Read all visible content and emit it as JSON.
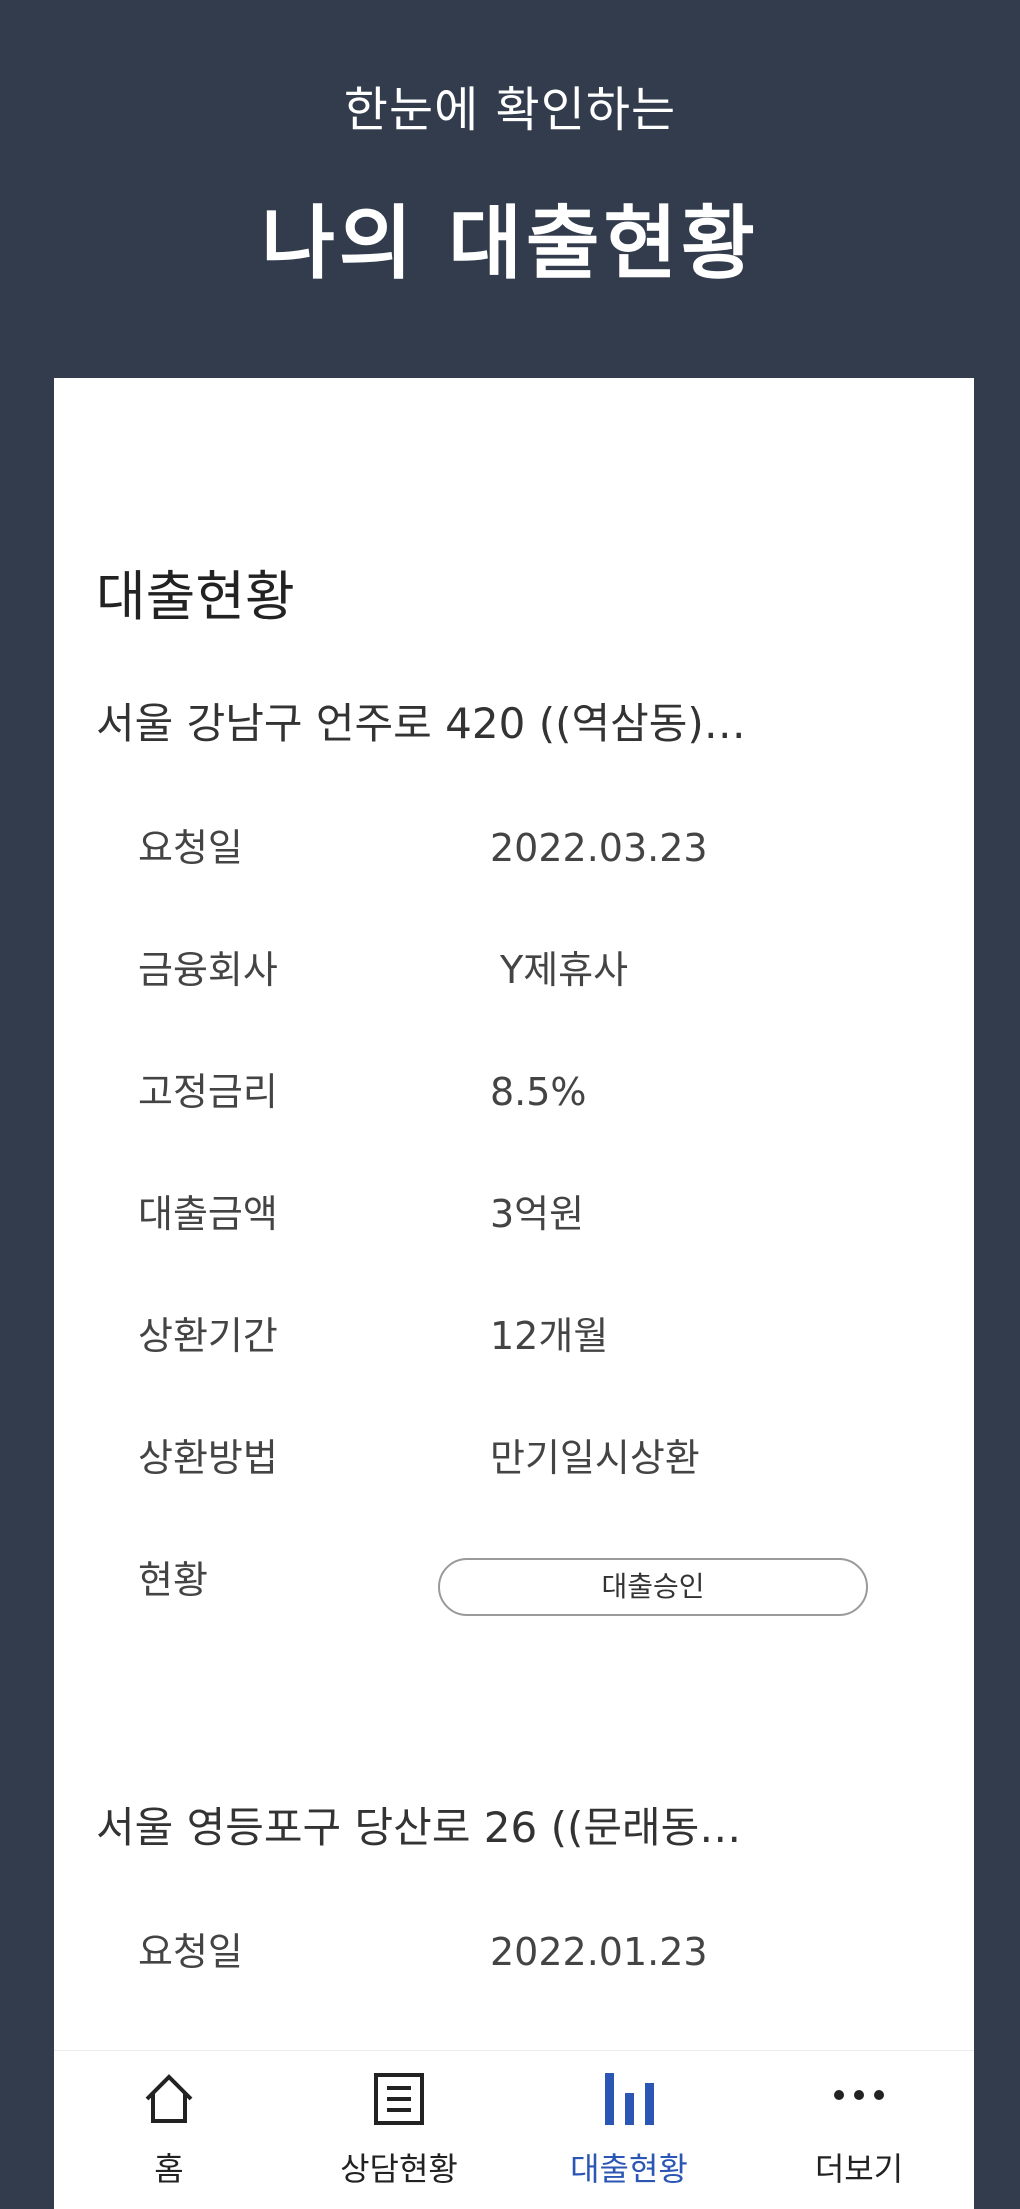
{
  "header": {
    "subtitle": "한눈에 확인하는",
    "title": "나의 대출현황"
  },
  "section": {
    "title": "대출현황"
  },
  "loans": [
    {
      "address": "서울 강남구 언주로 420 ((역삼동)…",
      "rows": [
        {
          "label": "요청일",
          "value": "2022.03.23"
        },
        {
          "label": "금융회사",
          "value": "Y제휴사"
        },
        {
          "label": "고정금리",
          "value": "8.5%"
        },
        {
          "label": "대출금액",
          "value": "3억원"
        },
        {
          "label": "상환기간",
          "value": "12개월"
        },
        {
          "label": "상환방법",
          "value": "만기일시상환"
        },
        {
          "label": "현황",
          "value": ""
        }
      ],
      "status": "대출승인"
    },
    {
      "address": "서울 영등포구 당산로 26 ((문래동…",
      "rows": [
        {
          "label": "요청일",
          "value": "2022.01.23"
        }
      ]
    }
  ],
  "nav": {
    "active_color": "#2c56b4",
    "items": [
      {
        "label": "홈",
        "icon": "home-icon"
      },
      {
        "label": "상담현황",
        "icon": "document-icon"
      },
      {
        "label": "대출현황",
        "icon": "bar-chart-icon",
        "active": true
      },
      {
        "label": "더보기",
        "icon": "more-icon"
      }
    ]
  }
}
